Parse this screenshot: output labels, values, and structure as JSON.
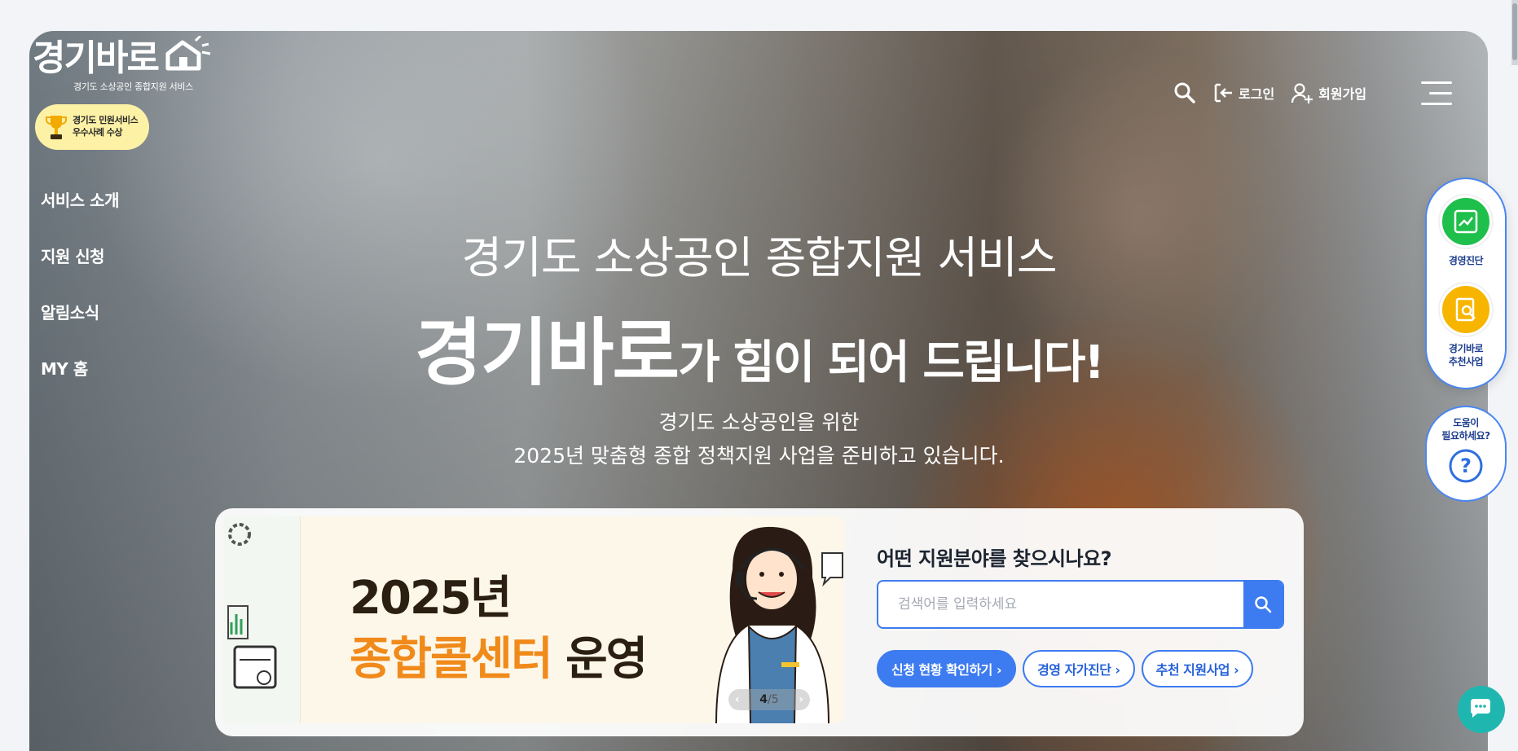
{
  "brand": {
    "logo_text": "경기바로",
    "logo_sub": "경기도 소상공인 종합지원 서비스",
    "award_line1": "경기도 민원서비스",
    "award_line2": "우수사례 수상"
  },
  "nav": {
    "items": [
      "서비스 소개",
      "지원 신청",
      "알림소식",
      "MY 홈"
    ]
  },
  "header": {
    "search_icon": "search-icon",
    "login": "로그인",
    "signup": "회원가입",
    "menu_icon": "hamburger-menu-icon"
  },
  "hero": {
    "subtitle": "경기도 소상공인 종합지원 서비스",
    "title_brand": "경기바로",
    "title_rest": "가 힘이 되어 드립니다!",
    "desc_line1": "경기도 소상공인을 위한",
    "desc_line2": "2025년 맞춤형 종합 정책지원 사업을 준비하고 있습니다."
  },
  "banner": {
    "year": "2025년",
    "line_orange": "종합콜센터",
    "line_dark": " 운영",
    "pager_current": "4",
    "pager_sep": "/",
    "pager_total": "5"
  },
  "search": {
    "title": "어떤 지원분야를 찾으시나요?",
    "placeholder": "검색어를 입력하세요",
    "chips": [
      "신청 현황 확인하기 ›",
      "경영 자가진단 ›",
      "추천 지원사업 ›"
    ]
  },
  "quick_menu": {
    "item1": "경영진단",
    "item2_line1": "경기바로",
    "item2_line2": "추천사업",
    "help_line1": "도움이",
    "help_line2": "필요하세요?"
  },
  "colors": {
    "accent": "#3d7bf0",
    "orange": "#f08a1a",
    "green": "#1fbf4c",
    "yellow": "#f7b500",
    "teal": "#20b6b0"
  }
}
